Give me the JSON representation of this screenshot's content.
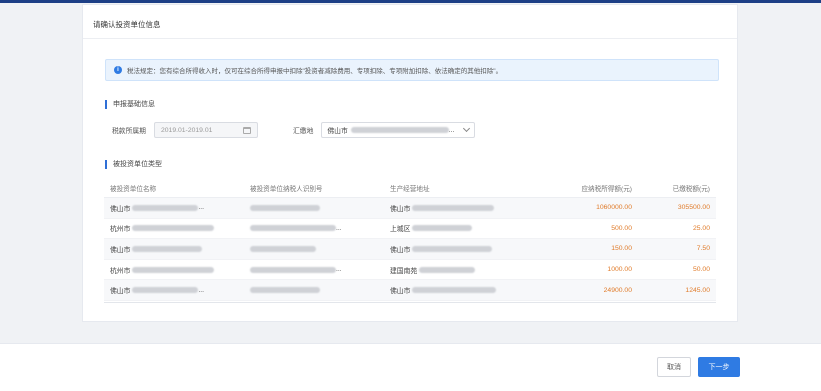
{
  "card": {
    "title": "请确认投资单位信息"
  },
  "notice": {
    "icon": "info-icon",
    "text": "税法规定：您有综合所得收入时，仅可在综合所得申报中扣除\"投资者减除费用、专项扣除、专项附加扣除、依法确定的其他扣除\"。"
  },
  "section_basic": {
    "label": "申报基础信息"
  },
  "form": {
    "period_label": "税款所属期",
    "period_value": "2019.01-2019.01",
    "location_label": "汇缴地",
    "location_value": "佛山市",
    "location_suffix": "..."
  },
  "section_units": {
    "label": "被投资单位类型"
  },
  "table": {
    "headers": [
      "被投资单位名称",
      "被投资单位纳税人识别号",
      "生产经营地址",
      "应纳税所得额(元)",
      "已缴税额(元)"
    ],
    "rows": [
      {
        "name": "佛山市",
        "name_suffix": "...",
        "taxid_suffix": "",
        "address": "佛山市",
        "income": "1060000.00",
        "tax": "305500.00"
      },
      {
        "name": "杭州市",
        "name_suffix": "",
        "taxid_suffix": "...",
        "address": "上城区",
        "income": "500.00",
        "tax": "25.00"
      },
      {
        "name": "佛山市",
        "name_suffix": "",
        "taxid_suffix": "",
        "address": "佛山市",
        "income": "150.00",
        "tax": "7.50"
      },
      {
        "name": "杭州市",
        "name_suffix": "",
        "taxid_suffix": "...",
        "address": "建国南苑",
        "income": "1000.00",
        "tax": "50.00"
      },
      {
        "name": "佛山市",
        "name_suffix": "...",
        "taxid_suffix": "",
        "address": "佛山市",
        "income": "24900.00",
        "tax": "1245.00"
      }
    ]
  },
  "footer": {
    "cancel_label": "取消",
    "next_label": "下一步"
  },
  "colors": {
    "accent": "#2f7be3",
    "amount": "#e07b2a"
  }
}
